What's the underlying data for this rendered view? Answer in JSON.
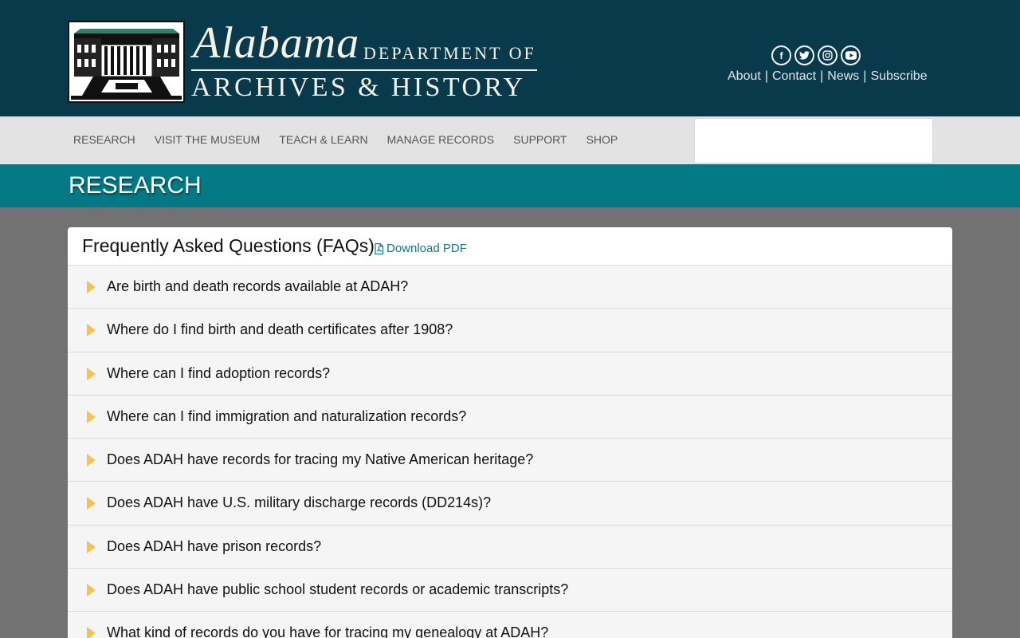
{
  "header": {
    "logo_script": "Alabama",
    "logo_dept": "DEPARTMENT OF",
    "logo_archives": "ARCHIVES & HISTORY",
    "social": [
      {
        "icon": "facebook-icon",
        "glyph": "f"
      },
      {
        "icon": "twitter-icon",
        "glyph": ""
      },
      {
        "icon": "instagram-icon",
        "glyph": ""
      },
      {
        "icon": "youtube-icon",
        "glyph": ""
      }
    ],
    "links": [
      "About",
      "Contact",
      "News",
      "Subscribe"
    ],
    "separator": "|"
  },
  "nav": {
    "items": [
      "RESEARCH",
      "VISIT THE MUSEUM",
      "TEACH & LEARN",
      "MANAGE RECORDS",
      "SUPPORT",
      "SHOP"
    ],
    "search_placeholder": ""
  },
  "banner": {
    "title": "RESEARCH"
  },
  "faq": {
    "title": "Frequently Asked Questions (FAQs)",
    "pdf_label": "Download PDF",
    "questions": [
      "Are birth and death records available at ADAH?",
      "Where do I find birth and death certificates after 1908?",
      "Where can I find adoption records?",
      "Where can I find immigration and naturalization records?",
      "Does ADAH have records for tracing my Native American heritage?",
      "Does ADAH have U.S. military discharge records (DD214s)?",
      "Does ADAH have prison records?",
      "Does ADAH have public school student records or academic transcripts?",
      "What kind of records do you have for tracing my genealogy at ADAH?"
    ]
  },
  "colors": {
    "header_bg": "#083a4c",
    "nav_bg": "#e3e3e3",
    "banner_bg": "#037985",
    "page_bg": "#727272",
    "accent_link": "#0c7a8a",
    "arrow": "#f5c34a"
  }
}
